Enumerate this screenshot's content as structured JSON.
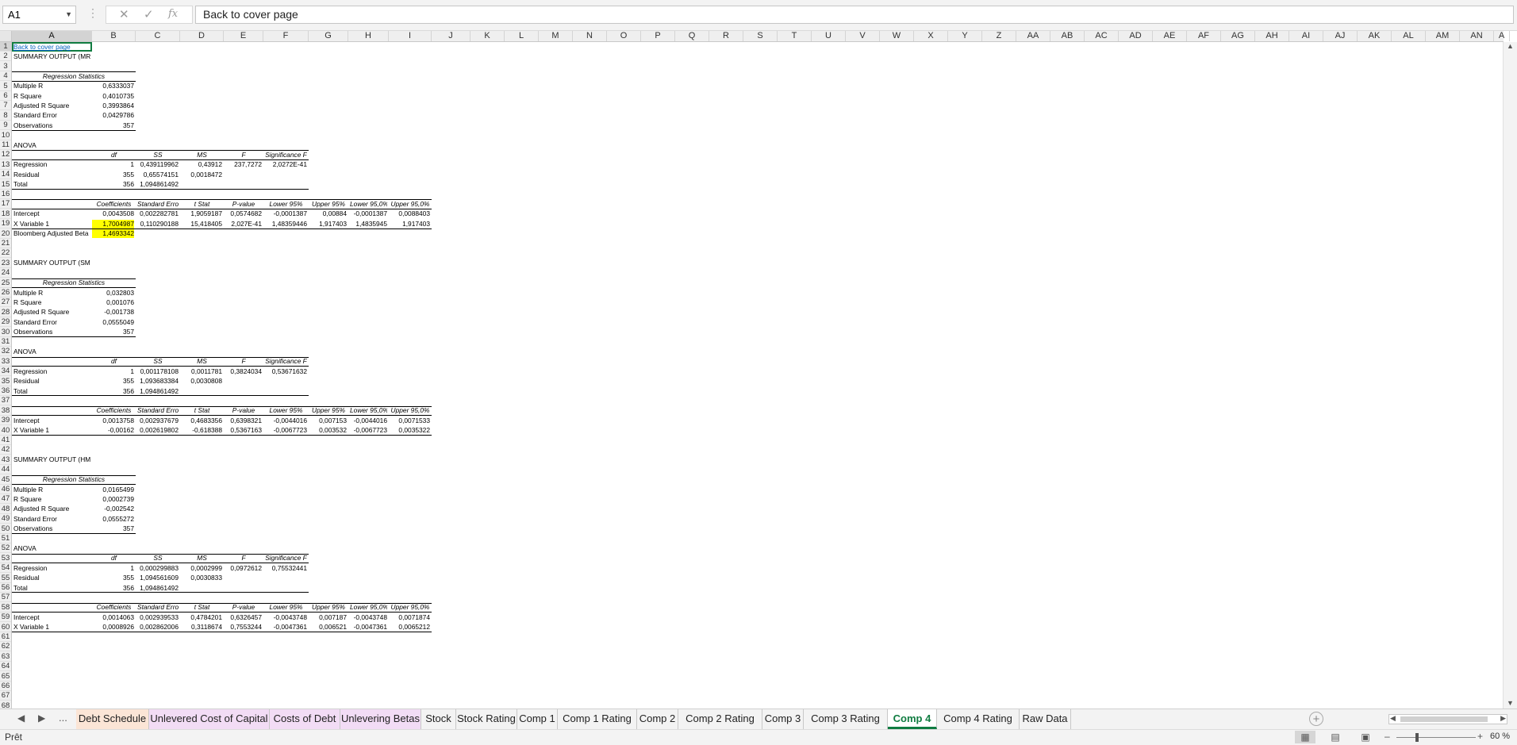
{
  "name_box": "A1",
  "formula": "Back to cover page",
  "columns": [
    "A",
    "B",
    "C",
    "D",
    "E",
    "F",
    "G",
    "H",
    "I",
    "J",
    "K",
    "L",
    "M",
    "N",
    "O",
    "P",
    "Q",
    "R",
    "S",
    "T",
    "U",
    "V",
    "W",
    "X",
    "Y",
    "Z",
    "AA",
    "AB",
    "AC",
    "AD",
    "AE",
    "AF",
    "AG",
    "AH",
    "AI",
    "AJ",
    "AK",
    "AL",
    "AM",
    "AN",
    "A"
  ],
  "rows": [
    "1",
    "2",
    "3",
    "4",
    "5",
    "6",
    "7",
    "8",
    "9",
    "10",
    "11",
    "12",
    "13",
    "14",
    "15",
    "16",
    "17",
    "18",
    "19",
    "20",
    "21",
    "22",
    "23",
    "24",
    "25",
    "26",
    "27",
    "28",
    "29",
    "30",
    "31",
    "32",
    "33",
    "34",
    "35",
    "36",
    "37",
    "38",
    "39",
    "40",
    "41",
    "42",
    "43",
    "44",
    "45",
    "46",
    "47",
    "48",
    "49",
    "50",
    "51",
    "52",
    "53",
    "54",
    "55",
    "56",
    "57",
    "58",
    "59",
    "60",
    "61",
    "62",
    "63",
    "64",
    "65",
    "66",
    "67",
    "68",
    "69"
  ],
  "cells": [
    {
      "r": 1,
      "c": "A",
      "v": "Back to cover page",
      "k": "link"
    },
    {
      "r": 2,
      "c": "A",
      "v": "SUMMARY OUTPUT (MRP)"
    },
    {
      "r": 4,
      "c": "A",
      "v": "Regression Statistics",
      "k": "hdr",
      "span": 2
    },
    {
      "r": 5,
      "c": "A",
      "v": "Multiple R"
    },
    {
      "r": 5,
      "c": "B",
      "v": "0,6333037",
      "k": "num"
    },
    {
      "r": 6,
      "c": "A",
      "v": "R Square"
    },
    {
      "r": 6,
      "c": "B",
      "v": "0,4010735",
      "k": "num"
    },
    {
      "r": 7,
      "c": "A",
      "v": "Adjusted R Square"
    },
    {
      "r": 7,
      "c": "B",
      "v": "0,3993864",
      "k": "num"
    },
    {
      "r": 8,
      "c": "A",
      "v": "Standard Error"
    },
    {
      "r": 8,
      "c": "B",
      "v": "0,0429786",
      "k": "num"
    },
    {
      "r": 9,
      "c": "A",
      "v": "Observations"
    },
    {
      "r": 9,
      "c": "B",
      "v": "357",
      "k": "num"
    },
    {
      "r": 11,
      "c": "A",
      "v": "ANOVA"
    },
    {
      "r": 12,
      "c": "B",
      "v": "df",
      "k": "hdr"
    },
    {
      "r": 12,
      "c": "C",
      "v": "SS",
      "k": "hdr"
    },
    {
      "r": 12,
      "c": "D",
      "v": "MS",
      "k": "hdr"
    },
    {
      "r": 12,
      "c": "E",
      "v": "F",
      "k": "hdr"
    },
    {
      "r": 12,
      "c": "F",
      "v": "Significance F",
      "k": "hdr"
    },
    {
      "r": 13,
      "c": "A",
      "v": "Regression"
    },
    {
      "r": 13,
      "c": "B",
      "v": "1",
      "k": "num"
    },
    {
      "r": 13,
      "c": "C",
      "v": "0,439119962",
      "k": "num"
    },
    {
      "r": 13,
      "c": "D",
      "v": "0,43912",
      "k": "num"
    },
    {
      "r": 13,
      "c": "E",
      "v": "237,7272",
      "k": "num"
    },
    {
      "r": 13,
      "c": "F",
      "v": "2,0272E-41",
      "k": "num"
    },
    {
      "r": 14,
      "c": "A",
      "v": "Residual"
    },
    {
      "r": 14,
      "c": "B",
      "v": "355",
      "k": "num"
    },
    {
      "r": 14,
      "c": "C",
      "v": "0,65574151",
      "k": "num"
    },
    {
      "r": 14,
      "c": "D",
      "v": "0,0018472",
      "k": "num"
    },
    {
      "r": 15,
      "c": "A",
      "v": "Total"
    },
    {
      "r": 15,
      "c": "B",
      "v": "356",
      "k": "num"
    },
    {
      "r": 15,
      "c": "C",
      "v": "1,094861492",
      "k": "num"
    },
    {
      "r": 17,
      "c": "B",
      "v": "Coefficients",
      "k": "hdr"
    },
    {
      "r": 17,
      "c": "C",
      "v": "Standard Error",
      "k": "hdr"
    },
    {
      "r": 17,
      "c": "D",
      "v": "t Stat",
      "k": "hdr"
    },
    {
      "r": 17,
      "c": "E",
      "v": "P-value",
      "k": "hdr"
    },
    {
      "r": 17,
      "c": "F",
      "v": "Lower 95%",
      "k": "hdr"
    },
    {
      "r": 17,
      "c": "G",
      "v": "Upper 95%",
      "k": "hdr"
    },
    {
      "r": 17,
      "c": "H",
      "v": "Lower 95,0%",
      "k": "hdr"
    },
    {
      "r": 17,
      "c": "I",
      "v": "Upper 95,0%",
      "k": "hdr"
    },
    {
      "r": 18,
      "c": "A",
      "v": "Intercept"
    },
    {
      "r": 18,
      "c": "B",
      "v": "0,0043508",
      "k": "num"
    },
    {
      "r": 18,
      "c": "C",
      "v": "0,002282781",
      "k": "num"
    },
    {
      "r": 18,
      "c": "D",
      "v": "1,9059187",
      "k": "num"
    },
    {
      "r": 18,
      "c": "E",
      "v": "0,0574682",
      "k": "num"
    },
    {
      "r": 18,
      "c": "F",
      "v": "-0,0001387",
      "k": "num"
    },
    {
      "r": 18,
      "c": "G",
      "v": "0,00884",
      "k": "num"
    },
    {
      "r": 18,
      "c": "H",
      "v": "-0,0001387",
      "k": "num"
    },
    {
      "r": 18,
      "c": "I",
      "v": "0,0088403",
      "k": "num"
    },
    {
      "r": 19,
      "c": "A",
      "v": "X Variable 1"
    },
    {
      "r": 19,
      "c": "B",
      "v": "1,7004987",
      "k": "num hl"
    },
    {
      "r": 19,
      "c": "C",
      "v": "0,110290188",
      "k": "num"
    },
    {
      "r": 19,
      "c": "D",
      "v": "15,418405",
      "k": "num"
    },
    {
      "r": 19,
      "c": "E",
      "v": "2,027E-41",
      "k": "num"
    },
    {
      "r": 19,
      "c": "F",
      "v": "1,48359446",
      "k": "num"
    },
    {
      "r": 19,
      "c": "G",
      "v": "1,917403",
      "k": "num"
    },
    {
      "r": 19,
      "c": "H",
      "v": "1,4835945",
      "k": "num"
    },
    {
      "r": 19,
      "c": "I",
      "v": "1,917403",
      "k": "num"
    },
    {
      "r": 20,
      "c": "A",
      "v": "Bloomberg Adjusted Beta"
    },
    {
      "r": 20,
      "c": "B",
      "v": "1,4693342",
      "k": "num hl"
    },
    {
      "r": 23,
      "c": "A",
      "v": "SUMMARY OUTPUT (SMB)"
    },
    {
      "r": 25,
      "c": "A",
      "v": "Regression Statistics",
      "k": "hdr",
      "span": 2
    },
    {
      "r": 26,
      "c": "A",
      "v": "Multiple R"
    },
    {
      "r": 26,
      "c": "B",
      "v": "0,032803",
      "k": "num"
    },
    {
      "r": 27,
      "c": "A",
      "v": "R Square"
    },
    {
      "r": 27,
      "c": "B",
      "v": "0,001076",
      "k": "num"
    },
    {
      "r": 28,
      "c": "A",
      "v": "Adjusted R Square"
    },
    {
      "r": 28,
      "c": "B",
      "v": "-0,001738",
      "k": "num"
    },
    {
      "r": 29,
      "c": "A",
      "v": "Standard Error"
    },
    {
      "r": 29,
      "c": "B",
      "v": "0,0555049",
      "k": "num"
    },
    {
      "r": 30,
      "c": "A",
      "v": "Observations"
    },
    {
      "r": 30,
      "c": "B",
      "v": "357",
      "k": "num"
    },
    {
      "r": 32,
      "c": "A",
      "v": "ANOVA"
    },
    {
      "r": 33,
      "c": "B",
      "v": "df",
      "k": "hdr"
    },
    {
      "r": 33,
      "c": "C",
      "v": "SS",
      "k": "hdr"
    },
    {
      "r": 33,
      "c": "D",
      "v": "MS",
      "k": "hdr"
    },
    {
      "r": 33,
      "c": "E",
      "v": "F",
      "k": "hdr"
    },
    {
      "r": 33,
      "c": "F",
      "v": "Significance F",
      "k": "hdr"
    },
    {
      "r": 34,
      "c": "A",
      "v": "Regression"
    },
    {
      "r": 34,
      "c": "B",
      "v": "1",
      "k": "num"
    },
    {
      "r": 34,
      "c": "C",
      "v": "0,001178108",
      "k": "num"
    },
    {
      "r": 34,
      "c": "D",
      "v": "0,0011781",
      "k": "num"
    },
    {
      "r": 34,
      "c": "E",
      "v": "0,3824034",
      "k": "num"
    },
    {
      "r": 34,
      "c": "F",
      "v": "0,53671632",
      "k": "num"
    },
    {
      "r": 35,
      "c": "A",
      "v": "Residual"
    },
    {
      "r": 35,
      "c": "B",
      "v": "355",
      "k": "num"
    },
    {
      "r": 35,
      "c": "C",
      "v": "1,093683384",
      "k": "num"
    },
    {
      "r": 35,
      "c": "D",
      "v": "0,0030808",
      "k": "num"
    },
    {
      "r": 36,
      "c": "A",
      "v": "Total"
    },
    {
      "r": 36,
      "c": "B",
      "v": "356",
      "k": "num"
    },
    {
      "r": 36,
      "c": "C",
      "v": "1,094861492",
      "k": "num"
    },
    {
      "r": 38,
      "c": "B",
      "v": "Coefficients",
      "k": "hdr"
    },
    {
      "r": 38,
      "c": "C",
      "v": "Standard Error",
      "k": "hdr"
    },
    {
      "r": 38,
      "c": "D",
      "v": "t Stat",
      "k": "hdr"
    },
    {
      "r": 38,
      "c": "E",
      "v": "P-value",
      "k": "hdr"
    },
    {
      "r": 38,
      "c": "F",
      "v": "Lower 95%",
      "k": "hdr"
    },
    {
      "r": 38,
      "c": "G",
      "v": "Upper 95%",
      "k": "hdr"
    },
    {
      "r": 38,
      "c": "H",
      "v": "Lower 95,0%",
      "k": "hdr"
    },
    {
      "r": 38,
      "c": "I",
      "v": "Upper 95,0%",
      "k": "hdr"
    },
    {
      "r": 39,
      "c": "A",
      "v": "Intercept"
    },
    {
      "r": 39,
      "c": "B",
      "v": "0,0013758",
      "k": "num"
    },
    {
      "r": 39,
      "c": "C",
      "v": "0,002937679",
      "k": "num"
    },
    {
      "r": 39,
      "c": "D",
      "v": "0,4683356",
      "k": "num"
    },
    {
      "r": 39,
      "c": "E",
      "v": "0,6398321",
      "k": "num"
    },
    {
      "r": 39,
      "c": "F",
      "v": "-0,0044016",
      "k": "num"
    },
    {
      "r": 39,
      "c": "G",
      "v": "0,007153",
      "k": "num"
    },
    {
      "r": 39,
      "c": "H",
      "v": "-0,0044016",
      "k": "num"
    },
    {
      "r": 39,
      "c": "I",
      "v": "0,0071533",
      "k": "num"
    },
    {
      "r": 40,
      "c": "A",
      "v": "X Variable 1"
    },
    {
      "r": 40,
      "c": "B",
      "v": "-0,00162",
      "k": "num"
    },
    {
      "r": 40,
      "c": "C",
      "v": "0,002619802",
      "k": "num"
    },
    {
      "r": 40,
      "c": "D",
      "v": "-0,618388",
      "k": "num"
    },
    {
      "r": 40,
      "c": "E",
      "v": "0,5367163",
      "k": "num"
    },
    {
      "r": 40,
      "c": "F",
      "v": "-0,0067723",
      "k": "num"
    },
    {
      "r": 40,
      "c": "G",
      "v": "0,003532",
      "k": "num"
    },
    {
      "r": 40,
      "c": "H",
      "v": "-0,0067723",
      "k": "num"
    },
    {
      "r": 40,
      "c": "I",
      "v": "0,0035322",
      "k": "num"
    },
    {
      "r": 43,
      "c": "A",
      "v": "SUMMARY OUTPUT (HML)"
    },
    {
      "r": 45,
      "c": "A",
      "v": "Regression Statistics",
      "k": "hdr",
      "span": 2
    },
    {
      "r": 46,
      "c": "A",
      "v": "Multiple R"
    },
    {
      "r": 46,
      "c": "B",
      "v": "0,0165499",
      "k": "num"
    },
    {
      "r": 47,
      "c": "A",
      "v": "R Square"
    },
    {
      "r": 47,
      "c": "B",
      "v": "0,0002739",
      "k": "num"
    },
    {
      "r": 48,
      "c": "A",
      "v": "Adjusted R Square"
    },
    {
      "r": 48,
      "c": "B",
      "v": "-0,002542",
      "k": "num"
    },
    {
      "r": 49,
      "c": "A",
      "v": "Standard Error"
    },
    {
      "r": 49,
      "c": "B",
      "v": "0,0555272",
      "k": "num"
    },
    {
      "r": 50,
      "c": "A",
      "v": "Observations"
    },
    {
      "r": 50,
      "c": "B",
      "v": "357",
      "k": "num"
    },
    {
      "r": 52,
      "c": "A",
      "v": "ANOVA"
    },
    {
      "r": 53,
      "c": "B",
      "v": "df",
      "k": "hdr"
    },
    {
      "r": 53,
      "c": "C",
      "v": "SS",
      "k": "hdr"
    },
    {
      "r": 53,
      "c": "D",
      "v": "MS",
      "k": "hdr"
    },
    {
      "r": 53,
      "c": "E",
      "v": "F",
      "k": "hdr"
    },
    {
      "r": 53,
      "c": "F",
      "v": "Significance F",
      "k": "hdr"
    },
    {
      "r": 54,
      "c": "A",
      "v": "Regression"
    },
    {
      "r": 54,
      "c": "B",
      "v": "1",
      "k": "num"
    },
    {
      "r": 54,
      "c": "C",
      "v": "0,000299883",
      "k": "num"
    },
    {
      "r": 54,
      "c": "D",
      "v": "0,0002999",
      "k": "num"
    },
    {
      "r": 54,
      "c": "E",
      "v": "0,0972612",
      "k": "num"
    },
    {
      "r": 54,
      "c": "F",
      "v": "0,75532441",
      "k": "num"
    },
    {
      "r": 55,
      "c": "A",
      "v": "Residual"
    },
    {
      "r": 55,
      "c": "B",
      "v": "355",
      "k": "num"
    },
    {
      "r": 55,
      "c": "C",
      "v": "1,094561609",
      "k": "num"
    },
    {
      "r": 55,
      "c": "D",
      "v": "0,0030833",
      "k": "num"
    },
    {
      "r": 56,
      "c": "A",
      "v": "Total"
    },
    {
      "r": 56,
      "c": "B",
      "v": "356",
      "k": "num"
    },
    {
      "r": 56,
      "c": "C",
      "v": "1,094861492",
      "k": "num"
    },
    {
      "r": 58,
      "c": "B",
      "v": "Coefficients",
      "k": "hdr"
    },
    {
      "r": 58,
      "c": "C",
      "v": "Standard Error",
      "k": "hdr"
    },
    {
      "r": 58,
      "c": "D",
      "v": "t Stat",
      "k": "hdr"
    },
    {
      "r": 58,
      "c": "E",
      "v": "P-value",
      "k": "hdr"
    },
    {
      "r": 58,
      "c": "F",
      "v": "Lower 95%",
      "k": "hdr"
    },
    {
      "r": 58,
      "c": "G",
      "v": "Upper 95%",
      "k": "hdr"
    },
    {
      "r": 58,
      "c": "H",
      "v": "Lower 95,0%",
      "k": "hdr"
    },
    {
      "r": 58,
      "c": "I",
      "v": "Upper 95,0%",
      "k": "hdr"
    },
    {
      "r": 59,
      "c": "A",
      "v": "Intercept"
    },
    {
      "r": 59,
      "c": "B",
      "v": "0,0014063",
      "k": "num"
    },
    {
      "r": 59,
      "c": "C",
      "v": "0,002939533",
      "k": "num"
    },
    {
      "r": 59,
      "c": "D",
      "v": "0,4784201",
      "k": "num"
    },
    {
      "r": 59,
      "c": "E",
      "v": "0,6326457",
      "k": "num"
    },
    {
      "r": 59,
      "c": "F",
      "v": "-0,0043748",
      "k": "num"
    },
    {
      "r": 59,
      "c": "G",
      "v": "0,007187",
      "k": "num"
    },
    {
      "r": 59,
      "c": "H",
      "v": "-0,0043748",
      "k": "num"
    },
    {
      "r": 59,
      "c": "I",
      "v": "0,0071874",
      "k": "num"
    },
    {
      "r": 60,
      "c": "A",
      "v": "X Variable 1"
    },
    {
      "r": 60,
      "c": "B",
      "v": "0,0008926",
      "k": "num"
    },
    {
      "r": 60,
      "c": "C",
      "v": "0,002862006",
      "k": "num"
    },
    {
      "r": 60,
      "c": "D",
      "v": "0,3118674",
      "k": "num"
    },
    {
      "r": 60,
      "c": "E",
      "v": "0,7553244",
      "k": "num"
    },
    {
      "r": 60,
      "c": "F",
      "v": "-0,0047361",
      "k": "num"
    },
    {
      "r": 60,
      "c": "G",
      "v": "0,006521",
      "k": "num"
    },
    {
      "r": 60,
      "c": "H",
      "v": "-0,0047361",
      "k": "num"
    },
    {
      "r": 60,
      "c": "I",
      "v": "0,0065212",
      "k": "num"
    }
  ],
  "borders": [
    {
      "r": 4,
      "from": "A",
      "to": "B",
      "edge": "top"
    },
    {
      "r": 4,
      "from": "A",
      "to": "B",
      "edge": "bottom"
    },
    {
      "r": 9,
      "from": "A",
      "to": "B",
      "edge": "bottom"
    },
    {
      "r": 12,
      "from": "A",
      "to": "F",
      "edge": "top"
    },
    {
      "r": 12,
      "from": "A",
      "to": "F",
      "edge": "bottom"
    },
    {
      "r": 15,
      "from": "A",
      "to": "F",
      "edge": "bottom"
    },
    {
      "r": 17,
      "from": "A",
      "to": "I",
      "edge": "top"
    },
    {
      "r": 17,
      "from": "A",
      "to": "I",
      "edge": "bottom"
    },
    {
      "r": 19,
      "from": "A",
      "to": "I",
      "edge": "bottom"
    },
    {
      "r": 25,
      "from": "A",
      "to": "B",
      "edge": "top"
    },
    {
      "r": 25,
      "from": "A",
      "to": "B",
      "edge": "bottom"
    },
    {
      "r": 30,
      "from": "A",
      "to": "B",
      "edge": "bottom"
    },
    {
      "r": 33,
      "from": "A",
      "to": "F",
      "edge": "top"
    },
    {
      "r": 33,
      "from": "A",
      "to": "F",
      "edge": "bottom"
    },
    {
      "r": 36,
      "from": "A",
      "to": "F",
      "edge": "bottom"
    },
    {
      "r": 38,
      "from": "A",
      "to": "I",
      "edge": "top"
    },
    {
      "r": 38,
      "from": "A",
      "to": "I",
      "edge": "bottom"
    },
    {
      "r": 40,
      "from": "A",
      "to": "I",
      "edge": "bottom"
    },
    {
      "r": 45,
      "from": "A",
      "to": "B",
      "edge": "top"
    },
    {
      "r": 45,
      "from": "A",
      "to": "B",
      "edge": "bottom"
    },
    {
      "r": 50,
      "from": "A",
      "to": "B",
      "edge": "bottom"
    },
    {
      "r": 53,
      "from": "A",
      "to": "F",
      "edge": "top"
    },
    {
      "r": 53,
      "from": "A",
      "to": "F",
      "edge": "bottom"
    },
    {
      "r": 56,
      "from": "A",
      "to": "F",
      "edge": "bottom"
    },
    {
      "r": 58,
      "from": "A",
      "to": "I",
      "edge": "top"
    },
    {
      "r": 58,
      "from": "A",
      "to": "I",
      "edge": "bottom"
    },
    {
      "r": 60,
      "from": "A",
      "to": "I",
      "edge": "bottom"
    }
  ],
  "highlight_color": "#ffff00",
  "accent_color": "#107c41",
  "tabs": [
    {
      "label": "Debt Schedule",
      "color": "#fbe5d6",
      "active": false
    },
    {
      "label": "Unlevered Cost of Capital",
      "color": "#f2dcf5",
      "active": false
    },
    {
      "label": "Costs of Debt",
      "color": "#f2dcf5",
      "active": false
    },
    {
      "label": "Unlevering Betas",
      "color": "#f2dcf5",
      "active": false
    },
    {
      "label": "Stock",
      "color": "",
      "active": false
    },
    {
      "label": "Stock Rating",
      "color": "",
      "active": false
    },
    {
      "label": "Comp 1",
      "color": "",
      "active": false
    },
    {
      "label": "Comp 1 Rating",
      "color": "",
      "active": false
    },
    {
      "label": "Comp 2",
      "color": "",
      "active": false
    },
    {
      "label": "Comp 2 Rating",
      "color": "",
      "active": false
    },
    {
      "label": "Comp 3",
      "color": "",
      "active": false
    },
    {
      "label": "Comp 3 Rating",
      "color": "",
      "active": false
    },
    {
      "label": "Comp 4",
      "color": "",
      "active": true
    },
    {
      "label": "Comp 4 Rating",
      "color": "",
      "active": false
    },
    {
      "label": "Raw Data",
      "color": "",
      "active": false
    }
  ],
  "tab_more": "...",
  "status": "Prêt",
  "zoom": "60 %",
  "icons": {
    "cancel": "cancel-icon",
    "confirm": "check-icon",
    "function": "fx-icon",
    "prev": "chevron-left-icon",
    "next": "chevron-right-icon",
    "add": "plus-icon"
  }
}
